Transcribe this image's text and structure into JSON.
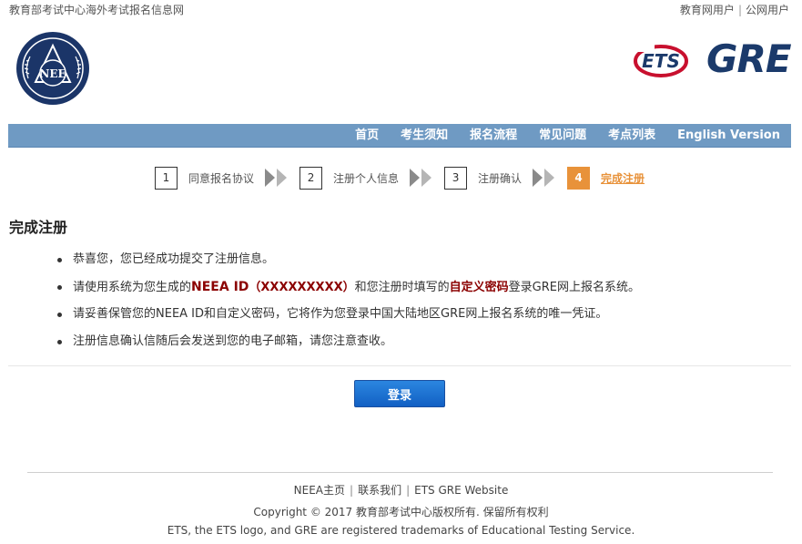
{
  "topbar": {
    "site_title": "教育部考试中心海外考试报名信息网",
    "user_links": [
      "教育网用户",
      "公网用户"
    ],
    "separator": "|"
  },
  "logos": {
    "neea_text": "NEE",
    "ets_text": "ETS",
    "gre_text": "GRE"
  },
  "nav": {
    "items": [
      "首页",
      "考生须知",
      "报名流程",
      "常见问题",
      "考点列表",
      "English Version"
    ]
  },
  "steps": [
    {
      "num": "1",
      "label": "同意报名协议",
      "active": false
    },
    {
      "num": "2",
      "label": "注册个人信息",
      "active": false
    },
    {
      "num": "3",
      "label": "注册确认",
      "active": false
    },
    {
      "num": "4",
      "label": "完成注册",
      "active": true
    }
  ],
  "main": {
    "title": "完成注册",
    "line1": "恭喜您，您已经成功提交了注册信息。",
    "line2_a": "请使用系统为您生成的",
    "line2_id_label": "NEEA ID",
    "line2_id_value": "（XXXXXXXXX）",
    "line2_b": "和您注册时填写的",
    "line2_pwd": "自定义密码",
    "line2_c": "登录GRE网上报名系统。",
    "line3": "请妥善保管您的NEEA ID和自定义密码，它将作为您登录中国大陆地区GRE网上报名系统的唯一凭证。",
    "line4": "注册信息确认信随后会发送到您的电子邮箱，请您注意查收。",
    "login_button": "登录"
  },
  "footer": {
    "links": [
      "NEEA主页",
      "联系我们",
      "ETS GRE Website"
    ],
    "separator": "|",
    "copyright": "Copyright © 2017 教育部考试中心版权所有. 保留所有权利",
    "trademark": "ETS, the ETS logo, and GRE are registered trademarks of Educational Testing Service."
  },
  "colors": {
    "nav_bg": "#6f9ac3",
    "active_step": "#e8923a",
    "highlight": "#8b0000",
    "button": "#1260c4"
  }
}
